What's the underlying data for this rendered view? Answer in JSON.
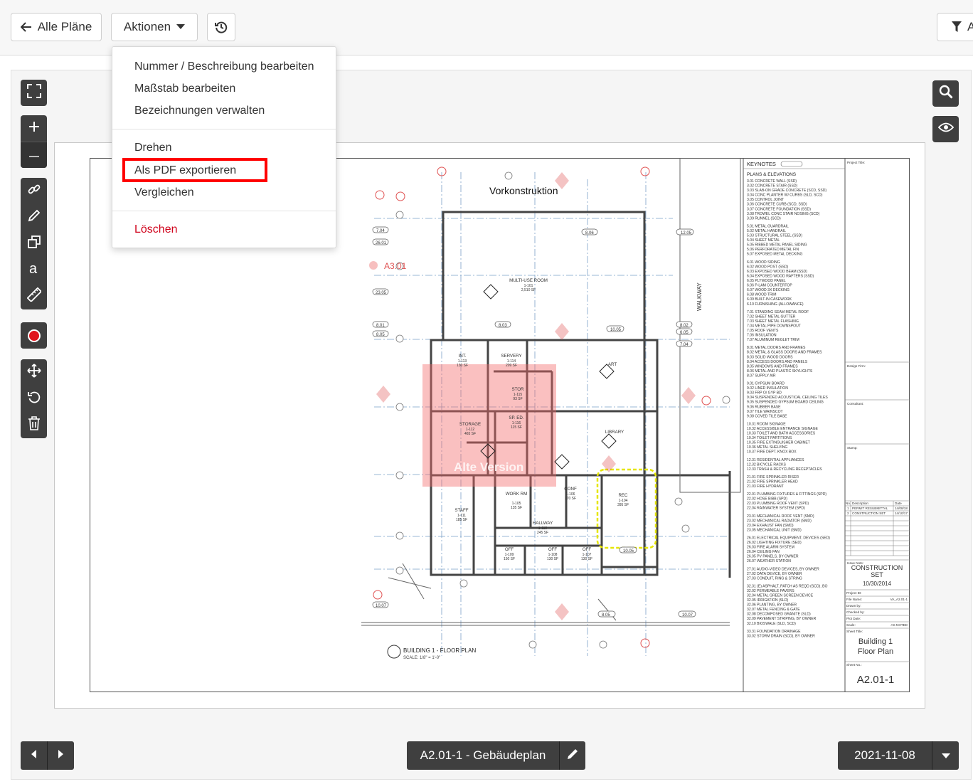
{
  "toolbar": {
    "back_label": "Alle Pläne",
    "actions_label": "Aktionen",
    "filter_label": "A"
  },
  "menu": {
    "items": [
      {
        "label": "Nummer / Beschreibung bearbeiten"
      },
      {
        "label": "Maßstab bearbeiten"
      },
      {
        "label": "Bezeichnungen verwalten"
      },
      {
        "label": "Drehen"
      },
      {
        "label": "Als PDF exportieren"
      },
      {
        "label": "Vergleichen"
      },
      {
        "label": "Löschen"
      }
    ]
  },
  "drawing": {
    "overlay_label": "Vorkonstruktion",
    "marker_label": "A3.01",
    "stamp_label": "Alte Version",
    "walkway": "WALKWAY",
    "rooms": [
      {
        "name": "MULTI-USE ROOM",
        "num": "1-101",
        "area": "2,510 SF"
      },
      {
        "name": "SERVERY",
        "num": "1-114",
        "area": "209 SF"
      },
      {
        "name": "INT.",
        "num": "1-113",
        "area": "130 SF"
      },
      {
        "name": "ART"
      },
      {
        "name": "STOR",
        "num": "1-115",
        "area": "93 SF"
      },
      {
        "name": "SP. ED.",
        "num": "1-116",
        "area": "115 SF"
      },
      {
        "name": "STORAGE",
        "num": "1-112",
        "area": "465 SF"
      },
      {
        "name": "LIBRARY"
      },
      {
        "name": "CONF",
        "num": "1-106",
        "area": "170 SF"
      },
      {
        "name": "WORK RM",
        "num": "1-105",
        "area": "135 SF"
      },
      {
        "name": "REC",
        "num": "1-104",
        "area": "395 SF"
      },
      {
        "name": "STAFF",
        "num": "1-111",
        "area": "185 SF"
      },
      {
        "name": "HALLWAY",
        "num": "1-118",
        "area": "245 SF"
      },
      {
        "name": "OFF",
        "num": "1-109",
        "area": "150 SF"
      },
      {
        "name": "OFF",
        "num": "1-108",
        "area": "130 SF"
      },
      {
        "name": "OFF",
        "num": "1-107",
        "area": "130 SF"
      }
    ],
    "plan_caption": "BUILDING 1 - FLOOR PLAN",
    "plan_scale": "SCALE: 1/8\" = 1'-0\"",
    "keynotes_title": "KEYNOTES",
    "keynotes_sub": "PLANS & ELEVATIONS",
    "keynotes": [
      "3.01 CONCRETE WALL (SSD)",
      "3.02 CONCRETE STAIR (SSD)",
      "3.03 SLAB-ON GRADE CONCRETE (SCD, SSD)",
      "3.04 CONC PLANTER W/ CURBS (SLD, SCD)",
      "3.05 CONTROL JOINT",
      "3.06 CONCRETE CURB (SCD, SSD)",
      "3.07 CONCRETE FOUNDATION (SSD)",
      "3.08 TROWEL CONC STAIR NOSING (SCD)",
      "3.09 RUNNEL (SCD)",
      "",
      "5.01 METAL GUARDRAIL",
      "5.02 METAL HANDRAIL",
      "5.03 STRUCTURAL STEEL (SSD)",
      "5.04 SHEET METAL",
      "5.05 RIBBED METAL PANEL SIDING",
      "5.06 PERFORATED METAL FIN",
      "5.07 EXPOSED METAL DECKING",
      "",
      "6.01 WOOD SIDING",
      "6.02 WOOD POST (SSD)",
      "6.03 EXPOSED WOOD BEAM (SSD)",
      "6.04 EXPOSED WOOD RAFTERS (SSD)",
      "6.05 PLYWOOD PANEL",
      "6.06 P-LAM COUNTERTOP",
      "6.07 WOOD 3X DECKING",
      "6.08 WOOD TRIM",
      "6.09 BUILT-IN CASEWORK",
      "6.10 FURNISHING (ALLOWANCE)",
      "",
      "7.01 STANDING SEAM METAL ROOF",
      "7.02 SHEET METAL GUTTER",
      "7.03 SHEET METAL FLASHING",
      "7.04 METAL PIPE DOWNSPOUT",
      "7.05 ROOF VENTS",
      "7.06 INSULATION",
      "7.07 ALUMINUM REGLET TRIM",
      "",
      "8.01 METAL DOORS AND FRAMES",
      "8.02 METAL & GLASS DOORS AND FRAMES",
      "8.03 SOLID WOOD DOORS",
      "8.04 ACCESS DOORS AND PANELS",
      "8.05 WINDOWS AND FRAMES",
      "8.06 METAL AND PLASTIC SKYLIGHTS",
      "8.07 SUPPLY AIR",
      "",
      "9.01 GYPSUM BOARD",
      "9.02 LINED INSULATION",
      "9.03 FRP O/ GYP BD",
      "9.04 SUSPENDED ACOUSTICAL CEILING TILES",
      "9.05 SUSPENDED GYPSUM BOARD CEILING",
      "9.06 RUBBER BASE",
      "9.07 TILE WAINSCOT",
      "9.08 COVED TILE BASE",
      "",
      "10.31 ROOM SIGNAGE",
      "10.32 ACCESSIBLE ENTRANCE SIGNAGE",
      "10.33 TOILET AND BATH ACCESSORIES",
      "10.34 TOILET PARTITIONS",
      "10.35 FIRE EXTINGUISHER CABINET",
      "10.36 METAL SHELVING",
      "10.37 FIRE DEPT. KNOX BOX",
      "",
      "12.31 RESIDENTIAL APPLIANCES",
      "12.32 BICYCLE RACKS",
      "12.33 TRASH & RECYCLING RECEPTACLES",
      "",
      "21.01 FIRE SPRINKLER RISER",
      "21.02 FIRE SPRINKLER HEAD",
      "21.03 FIRE HYDRANT",
      "",
      "22.01 PLUMBING FIXTURES & FITTINGS (SPD)",
      "22.02 HOSE BIBB (SPD)",
      "22.03 PLUMBING ROOF VENT (SPD)",
      "22.04 RAINWATER SYSTEM (SPD)",
      "",
      "23.01 MECHANICAL ROOF VENT (SMD)",
      "23.02 MECHANICAL RADIATOR (SMD)",
      "23.04 EXHAUST FAN (SMD)",
      "23.05 MECHANICAL UNIT (SMD)",
      "",
      "26.01 ELECTRICAL EQUIPMENT, DEVICES (SED)",
      "26.02 LIGHTING FIXTURE (SED)",
      "26.03 FIRE ALARM SYSTEM",
      "26.04 CEILING FAN",
      "26.05 PV PANELS, BY OWNER",
      "26.07 WEATHER STATION",
      "",
      "27.01 AUDIO-VIDEO DEVICES, BY OWNER",
      "27.02 DATA DEVICE, BY OWNER",
      "27.03 CONDUIT, RING & STRING",
      "",
      "32.31 (E) ASPHALT, PATCH AS REQD (SCD), BO",
      "32.02 PERMEABLE PAVERS",
      "32.04 METAL GREEN SCREEN DEVICE",
      "32.05 IRRIGATION (SLD)",
      "32.06 PLANTING, BY OWNER",
      "32.07 METAL FENCING & GATE",
      "32.08 DECOMPOSED GRANITE (SLD)",
      "32.09 PAVEMENT STRIPING, BY OWNER",
      "32.10 BIOSWALE (SLD, SCD)",
      "",
      "33.31 FOUNDATION DRAINAGE",
      "33.02 STORM DRAIN (SCD), BY OWNER"
    ],
    "titleblock": {
      "project_title": "Project Title:",
      "design_firm": "Design Firm:",
      "consultant": "Consultant:",
      "stamp": "Stamp:",
      "rev_header": [
        "No.",
        "Description",
        "Date"
      ],
      "rev_rows": [
        [
          "1",
          "PERMIT RESUBMITTAL",
          "14/08/18"
        ],
        [
          "2",
          "CONSTRUCTION SET",
          "14/10/17"
        ]
      ],
      "issue_note": "Issue Note:",
      "issue_line1": "CONSTRUCTION",
      "issue_line2": "SET",
      "issue_date": "10/30/2014",
      "project_id": "Project ID:",
      "file_name": "File Name:",
      "file_name_val": "VA_A2.01-1",
      "drawn_by": "Drawn by:",
      "checked_by": "Checked by:",
      "plot_date": "Plot Date:",
      "scale_lbl": "Scale:",
      "scale_val": "AS NOTED",
      "sheet_title_lbl": "Sheet Title:",
      "sheet_title_1": "Building 1",
      "sheet_title_2": "Floor Plan",
      "sheet_no_lbl": "Sheet No.:",
      "sheet_no": "A2.01-1"
    }
  },
  "bottom": {
    "plan_label": "A2.01-1 - Gebäudeplan",
    "date_label": "2021-11-08"
  },
  "colors": {
    "toolbar_dark": "#3f3f3f",
    "danger": "#d0021b",
    "highlight": "#ff0000",
    "plan_red": "#e05252",
    "plan_blue": "#4a7fb5"
  }
}
